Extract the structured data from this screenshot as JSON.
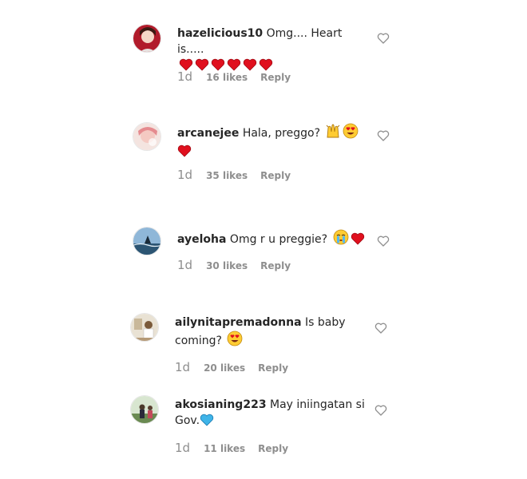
{
  "comments": [
    {
      "username": "hazelicious10",
      "text": "Omg.... Heart is.....",
      "emoji": [
        "red-heart",
        "red-heart",
        "red-heart",
        "red-heart",
        "red-heart",
        "red-heart"
      ],
      "time": "1d",
      "likes": "16 likes",
      "reply": "Reply",
      "avatar_colors": [
        "#b11b2b",
        "#f5d7c7"
      ]
    },
    {
      "username": "arcanejee",
      "text": "Hala, preggo?",
      "emoji": [
        "hands-raised-emoji",
        "heart-eyes-emoji",
        "red-heart"
      ],
      "time": "1d",
      "likes": "35 likes",
      "reply": "Reply",
      "avatar_colors": [
        "#f4c9c2",
        "#e58b8f"
      ]
    },
    {
      "username": "ayeloha",
      "text": "Omg r u preggie?",
      "emoji": [
        "crying-emoji",
        "red-heart"
      ],
      "time": "1d",
      "likes": "30 likes",
      "reply": "Reply",
      "avatar_colors": [
        "#8fb7d8",
        "#2c5573"
      ]
    },
    {
      "username": "ailynitapremadonna",
      "text": "Is baby coming?",
      "emoji": [
        "heart-eyes-emoji"
      ],
      "time": "1d",
      "likes": "20 likes",
      "reply": "Reply",
      "avatar_colors": [
        "#e9e2d4",
        "#7a5a3a"
      ]
    },
    {
      "username": "akosianing223",
      "text": "May iniingatan si Gov.",
      "emoji": [
        "blue-heart"
      ],
      "time": "1d",
      "likes": "11 likes",
      "reply": "Reply",
      "avatar_colors": [
        "#d8e6d0",
        "#4a6a3a"
      ]
    }
  ],
  "colors": {
    "text": "#262626",
    "meta": "#8e8e8e",
    "red_heart": "#e0101e",
    "blue_heart": "#3fb4e8",
    "emoji_yellow": "#ffcc33"
  }
}
